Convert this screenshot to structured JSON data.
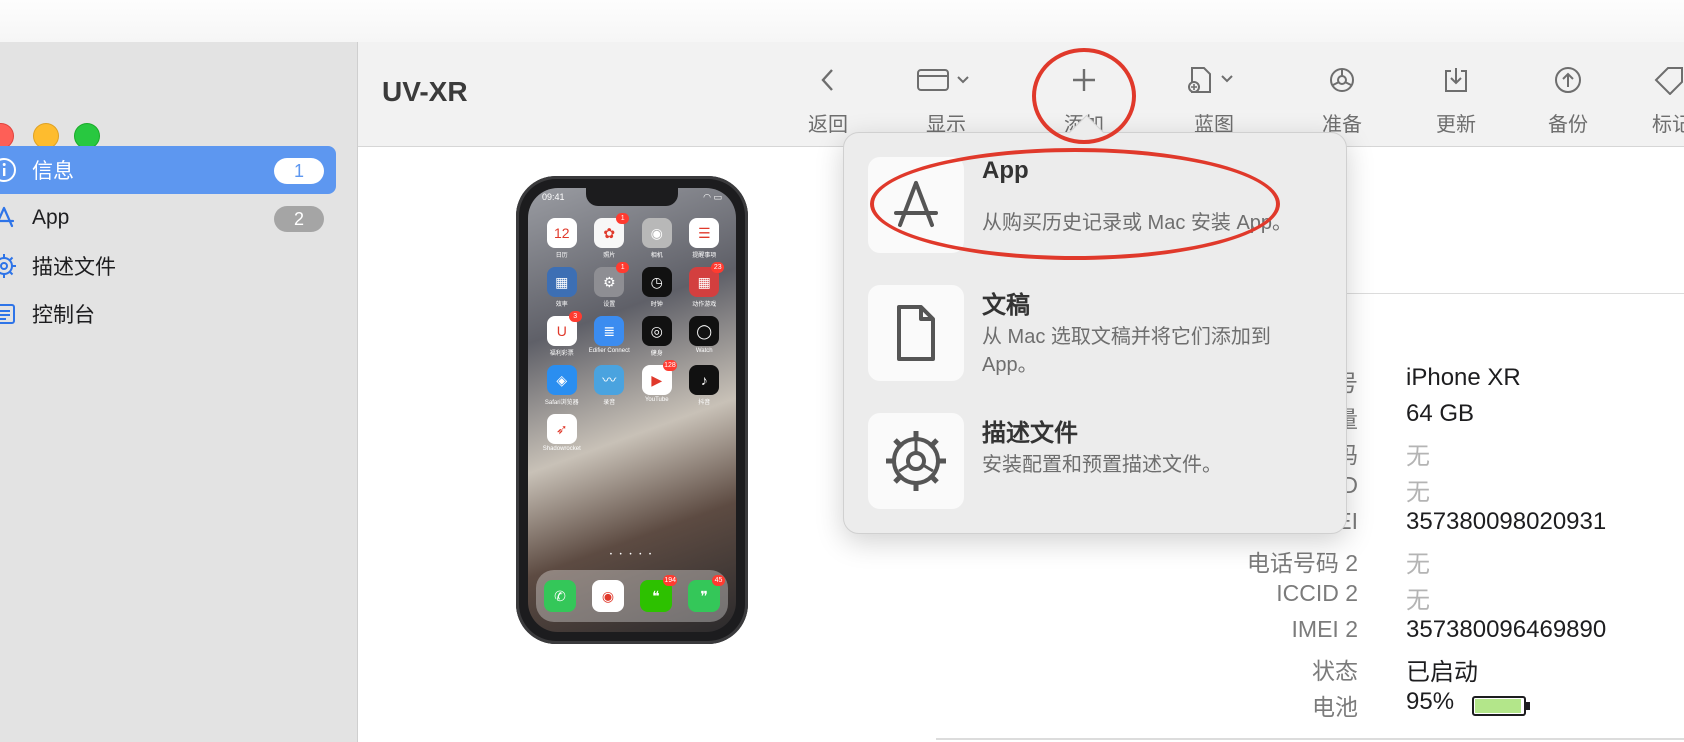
{
  "window": {
    "title": "UV-XR"
  },
  "toolbar": {
    "back_label": "返回",
    "view_label": "显示",
    "add_label": "添加",
    "blueprint_label": "蓝图",
    "prepare_label": "准备",
    "update_label": "更新",
    "backup_label": "备份",
    "tag_label": "标记"
  },
  "sidebar": {
    "items": [
      {
        "label": "信息",
        "badge": "1",
        "icon": "info-circle-icon",
        "active": true
      },
      {
        "label": "App",
        "badge": "2",
        "icon": "app-store-icon"
      },
      {
        "label": "描述文件",
        "icon": "gear-icon"
      },
      {
        "label": "控制台",
        "icon": "console-icon"
      }
    ]
  },
  "add_menu": {
    "items": [
      {
        "title": "App",
        "desc": "从购买历史记录或 Mac 安装 App。",
        "icon": "app-store-icon"
      },
      {
        "title": "文稿",
        "desc": "从 Mac 选取文稿并将它们添加到 App。",
        "icon": "document-icon"
      },
      {
        "title": "描述文件",
        "desc": "安装配置和预置描述文件。",
        "icon": "gear-icon"
      }
    ]
  },
  "device": {
    "status_bar": {
      "time": "09:41"
    },
    "home_apps": [
      {
        "name": "日历",
        "color": "#ffffff",
        "glyph": "12"
      },
      {
        "name": "照片",
        "color": "#f7f7f7",
        "glyph": "✿",
        "badge": "1"
      },
      {
        "name": "相机",
        "color": "#b8b8b8",
        "glyph": "◉"
      },
      {
        "name": "提醒事项",
        "color": "#ffffff",
        "glyph": "☰"
      },
      {
        "name": "效率",
        "color": "#3d6fb4",
        "glyph": "▦"
      },
      {
        "name": "设置",
        "color": "#8e8e93",
        "glyph": "⚙",
        "badge": "1"
      },
      {
        "name": "时钟",
        "color": "#111111",
        "glyph": "◷"
      },
      {
        "name": "动作游戏",
        "color": "#d33f3f",
        "glyph": "▦",
        "badge": "23"
      },
      {
        "name": "福利彩票",
        "color": "#ffffff",
        "glyph": "U",
        "badge": "3"
      },
      {
        "name": "Edifier Connect",
        "color": "#3b8cf0",
        "glyph": "≣"
      },
      {
        "name": "健身",
        "color": "#111111",
        "glyph": "◎"
      },
      {
        "name": "Watch",
        "color": "#111111",
        "glyph": "◯"
      },
      {
        "name": "Safari浏览器",
        "color": "#2a8ef0",
        "glyph": "◈"
      },
      {
        "name": "录音",
        "color": "#4aa3df",
        "glyph": "〰"
      },
      {
        "name": "YouTube",
        "color": "#ffffff",
        "glyph": "▶",
        "badge": "128"
      },
      {
        "name": "抖音",
        "color": "#111111",
        "glyph": "♪"
      },
      {
        "name": "Shadowrocket",
        "color": "#ffffff",
        "glyph": "➶"
      }
    ],
    "dock_apps": [
      {
        "name": "电话",
        "color": "#34c759",
        "glyph": "✆"
      },
      {
        "name": "Chrome",
        "color": "#ffffff",
        "glyph": "◉"
      },
      {
        "name": "微信",
        "color": "#2dc100",
        "glyph": "❝",
        "badge": "194"
      },
      {
        "name": "信息",
        "color": "#34c759",
        "glyph": "❞",
        "badge": "45"
      }
    ],
    "page_dots": "• • • • •"
  },
  "info": {
    "rows": [
      {
        "key": "型号",
        "value": "iPhone XR"
      },
      {
        "key": "容量",
        "value": "64 GB"
      },
      {
        "key": "电话号码",
        "value": "无",
        "none": true
      },
      {
        "key": "ICCID",
        "value": "无",
        "none": true
      },
      {
        "key": "IMEI",
        "value": "357380098020931"
      },
      {
        "key": "电话号码 2",
        "value": "无",
        "none": true
      },
      {
        "key": "ICCID 2",
        "value": "无",
        "none": true
      },
      {
        "key": "IMEI 2",
        "value": "357380096469890"
      },
      {
        "key": "状态",
        "value": "已启动"
      },
      {
        "key": "电池",
        "value": "95%"
      }
    ],
    "battery_level": 0.95,
    "battery_color": "#b3e68a"
  }
}
